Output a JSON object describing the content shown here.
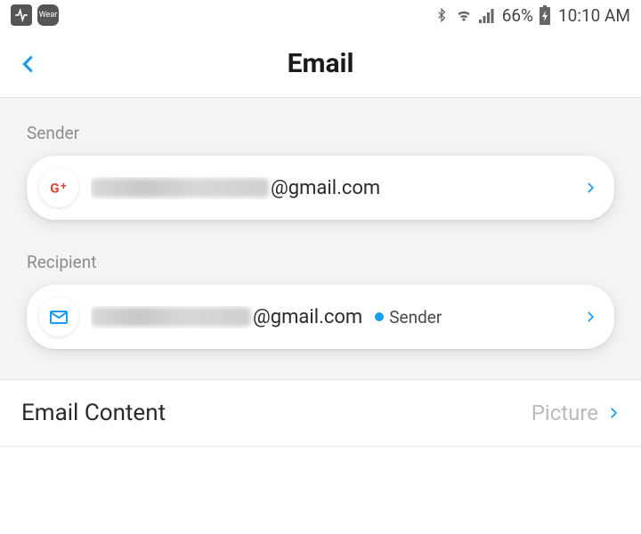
{
  "status_bar": {
    "wear_label": "Wear",
    "battery_percent": "66%",
    "time": "10:10 AM"
  },
  "header": {
    "title": "Email"
  },
  "sender": {
    "section_label": "Sender",
    "email_suffix": "@gmail.com"
  },
  "recipient": {
    "section_label": "Recipient",
    "email_suffix": "@gmail.com",
    "tag": "Sender"
  },
  "email_content": {
    "label": "Email Content",
    "value": "Picture"
  },
  "colors": {
    "accent": "#1a9df0",
    "google_red": "#db4437"
  }
}
